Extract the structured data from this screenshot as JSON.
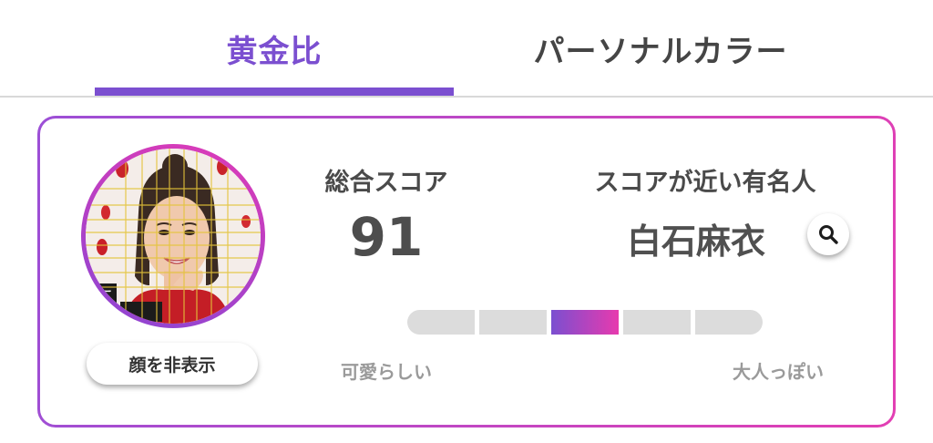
{
  "tabs": {
    "golden_ratio": "黄金比",
    "personal_color": "パーソナルカラー",
    "active": "golden_ratio"
  },
  "card": {
    "hide_face_button": "顔を非表示",
    "score": {
      "label": "総合スコア",
      "value": "91"
    },
    "celebrity": {
      "label": "スコアが近い有名人",
      "name": "白石麻衣",
      "search_icon": "search-icon"
    },
    "scale": {
      "left_label": "可愛らしい",
      "right_label": "大人っぽい",
      "segments": 5,
      "active_segment": 3
    }
  },
  "colors": {
    "accent": "#7b4fd0",
    "gradient_end": "#e73aae",
    "inactive_segment": "#dcdcdc"
  }
}
